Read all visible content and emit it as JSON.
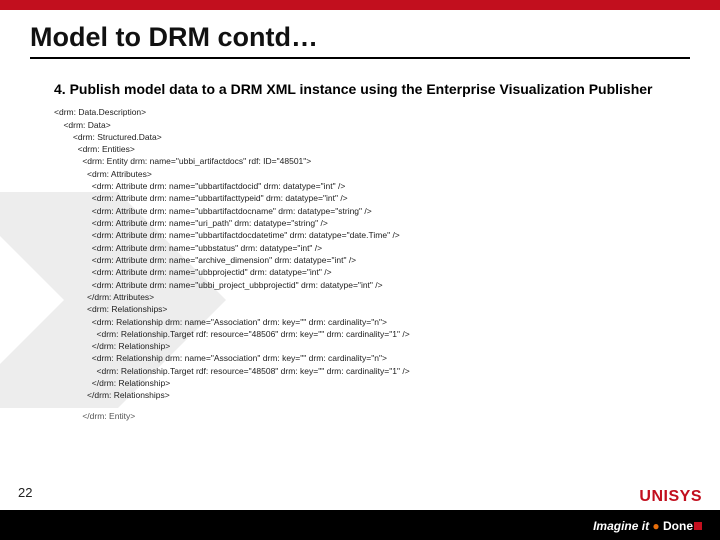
{
  "title": "Model to DRM contd…",
  "bullet": "4. Publish model data to a DRM XML instance using the Enterprise Visualization Publisher",
  "xml_lines": [
    "<drm: Data.Description>",
    "    <drm: Data>",
    "        <drm: Structured.Data>",
    "          <drm: Entities>",
    "            <drm: Entity drm: name=\"ubbi_artifactdocs\" rdf: ID=\"48501\">",
    "              <drm: Attributes>",
    "                <drm: Attribute drm: name=\"ubbartifactdocid\" drm: datatype=\"int\" />",
    "                <drm: Attribute drm: name=\"ubbartifacttypeid\" drm: datatype=\"int\" />",
    "                <drm: Attribute drm: name=\"ubbartifactdocname\" drm: datatype=\"string\" />",
    "                <drm: Attribute drm: name=\"uri_path\" drm: datatype=\"string\" />",
    "                <drm: Attribute drm: name=\"ubbartifactdocdatetime\" drm: datatype=\"date.Time\" />",
    "                <drm: Attribute drm: name=\"ubbstatus\" drm: datatype=\"int\" />",
    "                <drm: Attribute drm: name=\"archive_dimension\" drm: datatype=\"int\" />",
    "                <drm: Attribute drm: name=\"ubbprojectid\" drm: datatype=\"int\" />",
    "                <drm: Attribute drm: name=\"ubbi_project_ubbprojectid\" drm: datatype=\"int\" />",
    "              </drm: Attributes>",
    "              <drm: Relationships>",
    "                <drm: Relationship drm: name=\"Association\" drm: key=\"\" drm: cardinality=\"n\">",
    "                  <drm: Relationship.Target rdf: resource=\"48506\" drm: key=\"\" drm: cardinality=\"1\" />",
    "                </drm: Relationship>",
    "                <drm: Relationship drm: name=\"Association\" drm: key=\"\" drm: cardinality=\"n\">",
    "                  <drm: Relationship.Target rdf: resource=\"48508\" drm: key=\"\" drm: cardinality=\"1\" />",
    "                </drm: Relationship>",
    "              </drm: Relationships>"
  ],
  "xml_last_line": "            </drm: Entity>",
  "slide_number": "22",
  "logo_text": "UNISYS",
  "tagline_imagine": "Imagine it",
  "tagline_done": "Done"
}
